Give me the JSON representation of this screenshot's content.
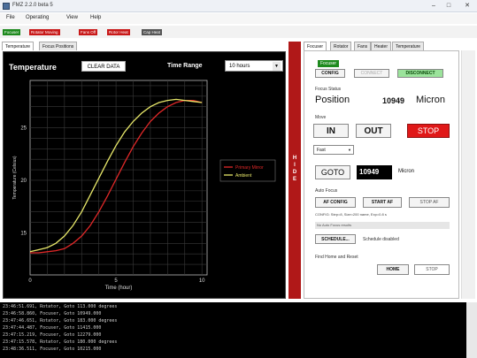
{
  "window": {
    "title": "FMZ 2.2.0 beta 5"
  },
  "menu": [
    "File",
    "Operating",
    "View",
    "Help"
  ],
  "status_indicators": [
    {
      "label": "Focuser",
      "color": "#1e8a1e"
    },
    {
      "label": "Rotator Moving",
      "color": "#c81818"
    },
    {
      "label": "Fans Off",
      "color": "#c81818"
    },
    {
      "label": "Rotor Heat",
      "color": "#c81818"
    },
    {
      "label": "Cap Heat",
      "color": "#555555"
    }
  ],
  "left_tabs": [
    "Temperature",
    "Focus Positions"
  ],
  "temperature_panel": {
    "title": "Temperature",
    "clear_button": "CLEAR DATA",
    "time_range_label": "Time Range",
    "time_range_value": "10 hours"
  },
  "chart_data": {
    "type": "line",
    "xlabel": "Time (hour)",
    "ylabel": "Temperature (Celsius)",
    "xlim": [
      0,
      10.3
    ],
    "ylim": [
      11,
      29.5
    ],
    "x_ticks": [
      0,
      5,
      10
    ],
    "y_ticks": [
      15,
      20,
      25
    ],
    "grid": true,
    "legend_position": "right",
    "series": [
      {
        "name": "Primary Mirror",
        "color": "#e02828",
        "x": [
          0,
          0.5,
          1.0,
          1.5,
          2.0,
          2.5,
          3.0,
          3.5,
          4.0,
          4.5,
          5.0,
          5.5,
          6.0,
          6.5,
          7.0,
          7.5,
          8.0,
          8.5,
          9.0,
          9.5,
          10.0
        ],
        "y": [
          13.1,
          13.1,
          13.2,
          13.3,
          13.5,
          14.0,
          14.7,
          15.7,
          17.0,
          18.5,
          20.1,
          21.7,
          23.2,
          24.5,
          25.6,
          26.4,
          27.0,
          27.4,
          27.6,
          27.6,
          27.4
        ]
      },
      {
        "name": "Ambient",
        "color": "#e8e86a",
        "x": [
          0,
          0.5,
          1.0,
          1.5,
          2.0,
          2.5,
          3.0,
          3.5,
          4.0,
          4.5,
          5.0,
          5.5,
          6.0,
          6.5,
          7.0,
          7.5,
          8.0,
          8.5,
          9.0,
          9.5,
          10.0
        ],
        "y": [
          13.2,
          13.4,
          13.6,
          14.0,
          14.7,
          15.7,
          17.0,
          18.6,
          20.2,
          21.8,
          23.3,
          24.6,
          25.6,
          26.4,
          27.0,
          27.4,
          27.6,
          27.7,
          27.6,
          27.5,
          27.4
        ]
      }
    ]
  },
  "hide_strip": {
    "label": "HIDE"
  },
  "right_tabs": [
    "Focuser",
    "Rotator",
    "Fans",
    "Heater",
    "Temperature"
  ],
  "focuser": {
    "badge": "Focuser",
    "config": "CONFIG",
    "connect": "CONNECT",
    "disconnect": "DISCONNECT",
    "status_label": "Focus Status",
    "position_label": "Position",
    "position_value": "10949",
    "position_unit": "Micron",
    "move_label": "Move",
    "btn_in": "IN",
    "btn_out": "OUT",
    "btn_stop": "STOP",
    "speed": "Fast",
    "goto": "GOTO",
    "goto_value": "10949",
    "goto_unit": "Micron",
    "autofocus_label": "Auto Focus",
    "af_config": "AF CONFIG",
    "start_af": "START AF",
    "stop_af": "STOP AF",
    "config_info": "CONFIG: Step=8, Size=200 name, Exp=0.8 s",
    "no_results": "No Auto Focus results",
    "schedule": "SCHEDULE...",
    "schedule_status": "Schedule disabled",
    "find_home_label": "Find Home and Reset",
    "home": "HOME",
    "stop_home": "STOP"
  },
  "log_lines": [
    "23:46:51.691, Rotator, Goto 113.000 degrees",
    "23:46:58.860, Focuser, Goto 10949.000",
    "23:47:46.651, Rotator, Goto 183.000 degrees",
    "23:47:44.487, Focuser, Goto 11415.000",
    "23:47:15.219, Focuser, Goto 12279.000",
    "23:47:15.578, Rotator, Goto 180.000 degrees",
    "23:48:36.511, Focuser, Goto 10215.000"
  ]
}
